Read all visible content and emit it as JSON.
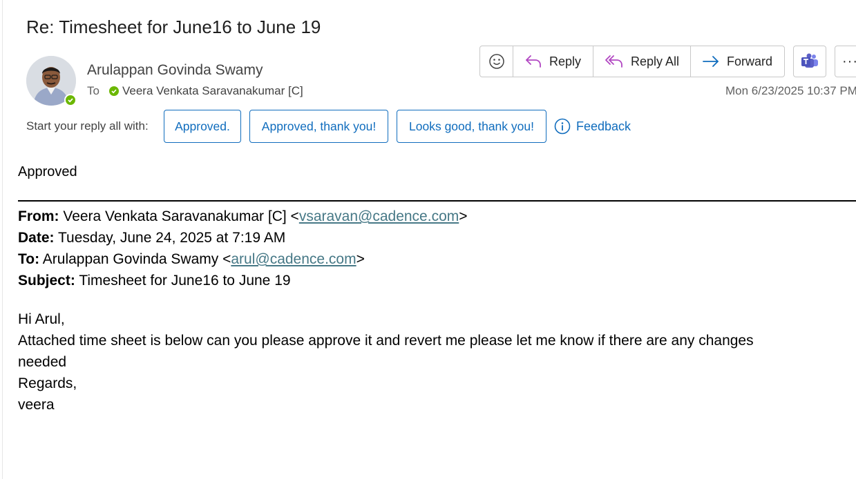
{
  "email": {
    "subject": "Re: Timesheet for June16 to June 19",
    "sender_name": "Arulappan Govinda Swamy",
    "to_label": "To",
    "recipient": "Veera Venkata Saravanakumar [C]",
    "date": "Mon 6/23/2025 10:37 PM"
  },
  "toolbar": {
    "reply_label": "Reply",
    "reply_all_label": "Reply All",
    "forward_label": "Forward",
    "more_label": "···"
  },
  "suggestions": {
    "label": "Start your reply all with:",
    "chips": [
      "Approved.",
      "Approved, thank you!",
      "Looks good, thank you!"
    ],
    "feedback_label": "Feedback"
  },
  "body": {
    "reply_text": "Approved",
    "quoted_header": {
      "from_label": "From:",
      "from_name": "Veera Venkata Saravanakumar [C] <",
      "from_email": "vsaravan@cadence.com",
      "from_close": ">",
      "date_label": "Date:",
      "date_value": "Tuesday, June 24, 2025 at 7:19 AM",
      "to_label": "To:",
      "to_name": "Arulappan Govinda Swamy <",
      "to_email": "arul@cadence.com",
      "to_close": ">",
      "subject_label": "Subject:",
      "subject_value": "Timesheet for June16 to June 19"
    },
    "message_lines": [
      "Hi Arul,",
      "Attached time sheet is below can you please approve it and revert me please let me know if there are any changes",
      "needed",
      "Regards,",
      "veera"
    ]
  },
  "colors": {
    "accent": "#0f6cbd",
    "presence_available": "#6bb700",
    "link": "#467886",
    "teams_purple": "#5b5fc7"
  }
}
